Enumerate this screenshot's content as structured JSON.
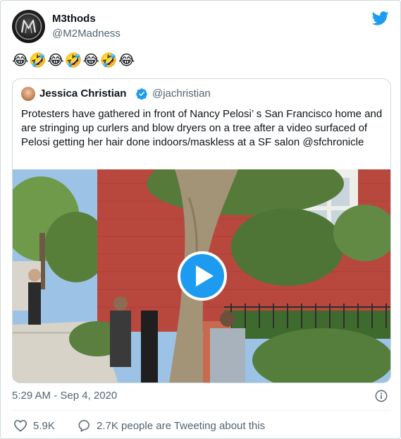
{
  "author": {
    "name": "M3thods",
    "handle": "@M2Madness"
  },
  "tweet": {
    "text": "😂🤣😂🤣😂🤣😂"
  },
  "quoted": {
    "name": "Jessica Christian",
    "handle": "@jachristian",
    "text": "Protesters have gathered in front of Nancy Pelosi’ s San Francisco home and are stringing up curlers and blow dryers on a tree after a video surfaced of Pelosi getting her hair done indoors/maskless at a SF salon @sfchronicle"
  },
  "meta": {
    "timestamp": "5:29 AM - Sep 4, 2020"
  },
  "actions": {
    "likes": "5.9K",
    "replies_text": "2.7K people are Tweeting about this"
  },
  "colors": {
    "accent": "#1d9bf0",
    "muted": "#536471",
    "border": "#cfd9de"
  },
  "icons": [
    "twitter-bird-icon",
    "verified-badge-icon",
    "play-icon",
    "info-icon",
    "heart-icon",
    "reply-bubble-icon"
  ]
}
